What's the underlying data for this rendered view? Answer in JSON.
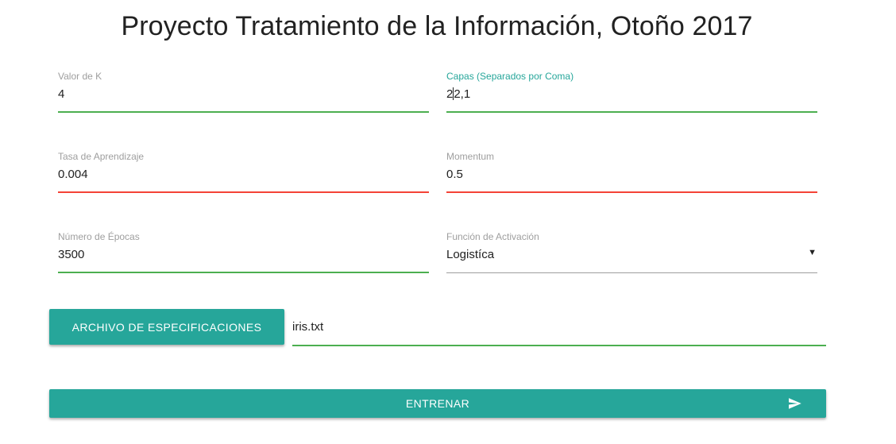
{
  "header": {
    "title": "Proyecto Tratamiento de la Información, Otoño 2017"
  },
  "form": {
    "k_value": {
      "label": "Valor de K",
      "value": "4",
      "state": "valid"
    },
    "layers": {
      "label": "Capas (Separados por Coma)",
      "value_before_caret": "2",
      "value_after_caret": "2,1",
      "state": "valid",
      "focused": true
    },
    "learning_rate": {
      "label": "Tasa de Aprendizaje",
      "value": "0.004",
      "state": "invalid"
    },
    "momentum": {
      "label": "Momentum",
      "value": "0.5",
      "state": "invalid"
    },
    "epochs": {
      "label": "Número de Épocas",
      "value": "3500",
      "state": "valid"
    },
    "activation": {
      "label": "Función de Activación",
      "selected": "Logistíca",
      "arrow_glyph": "▼"
    }
  },
  "file": {
    "button_label": "ARCHIVO DE ESPECIFICACIONES",
    "path_value": "iris.txt"
  },
  "train": {
    "button_label": "ENTRENAR",
    "icon": "send-icon"
  },
  "colors": {
    "accent": "#26a69a",
    "valid": "#4caf50",
    "invalid": "#f44336"
  }
}
